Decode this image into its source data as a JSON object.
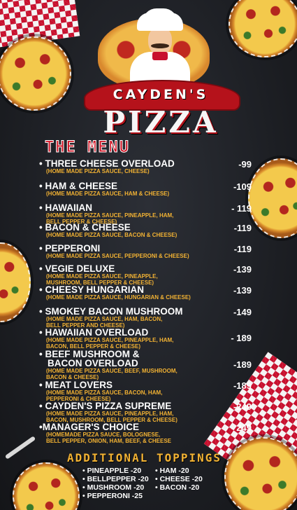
{
  "brand": {
    "name": "CAYDEN'S",
    "word": "PIZZA"
  },
  "menu_title": "THE MENU",
  "items": [
    {
      "name": "• THREE CHEESE OVERLOAD",
      "desc": "(HOME MADE PIZZA SAUCE, CHEESE)",
      "price": "-99"
    },
    {
      "name": "• HAM & CHEESE",
      "desc": "(HOME MADE PIZZA SAUCE, HAM & CHEESE)",
      "price": "-109"
    },
    {
      "name": "• HAWAIIAN",
      "desc": "(HOME MADE PIZZA SAUCE, PINEAPPLE, HAM,",
      "desc2": "BELL PEPPER & CHEESE)",
      "price": "- 119"
    },
    {
      "name": "• BACON & CHEESE",
      "desc": "(HOME MADE PIZZA SAUCE, BACON & CHEESE)",
      "price": "-119"
    },
    {
      "name": "• PEPPERONI",
      "desc": "(HOME MADE PIZZA SAUCE, PEPPERONI & CHEESE)",
      "price": "-119"
    },
    {
      "name": "• VEGIE DELUXE",
      "desc": "(HOME MADE PIZZA SAUCE, PINEAPPLE,",
      "desc2": "MUSHROOM, BELL PEPPER & CHEESE)",
      "price": "-139"
    },
    {
      "name": "• CHEESY HUNGARIAN",
      "desc": "(HOME MADE PIZZA SAUCE, HUNGARIAN & CHEESE)",
      "price": "-139"
    },
    {
      "name": "• SMOKEY BACON MUSHROOM",
      "desc": "(HOME MADE PIZZA SAUCE, HAM, BACON,",
      "desc2": "BELL PEPPER AND CHEESE)",
      "price": "-149"
    },
    {
      "name": "• HAWAIIAN OVERLOAD",
      "desc": "(HOME MADE PIZZA SAUCE, PINEAPPLE, HAM,",
      "desc2": "BACON, BELL PEPPER & CHEESE)",
      "price": "- 189"
    },
    {
      "name": "• BEEF MUSHROOM &",
      "name2": "BACON OVERLOAD",
      "desc": "(HOME MADE PIZZA SAUCE, BEEF, MUSHROOM,",
      "desc2": "BACON & CHEESE)",
      "price": "-189"
    },
    {
      "name": "• MEAT LOVERS",
      "desc": "(HOME MADE PIZZA SAUCE, BACON, HAM,",
      "desc2": "PEPPERONI & CHEESE)",
      "price": "-189"
    },
    {
      "name": "• CAYDEN'S PIZZA SUPREME",
      "desc": "(HOME MADE PIZZA SAUCE, PINEAPPLE, HAM,",
      "desc2": "BACON, MUSHROOM, BELL PEPPER & CHEESE)",
      "price": "-249"
    },
    {
      "name": "•MANAGER'S CHOICE",
      "desc": "(HOMEMADE PIZZA SAUCE, BOLOGNESE,",
      "desc2": "BELL PEPPER, ONION, HAM, BEEF, & CHEESE",
      "price": "- 249"
    }
  ],
  "additional": {
    "title": "ADDITIONAL TOPPINGS",
    "left": [
      "• PINEAPPLE  -20",
      "• BELLPEPPER -20",
      "• MUSHROOM -20",
      "• PEPPERONI  -25"
    ],
    "right": [
      "• HAM     -20",
      "• CHEESE -20",
      "• BACON  -20"
    ]
  },
  "colors": {
    "accent_red": "#d11a2a",
    "accent_gold": "#f2b233",
    "background": "#1d1f24"
  }
}
